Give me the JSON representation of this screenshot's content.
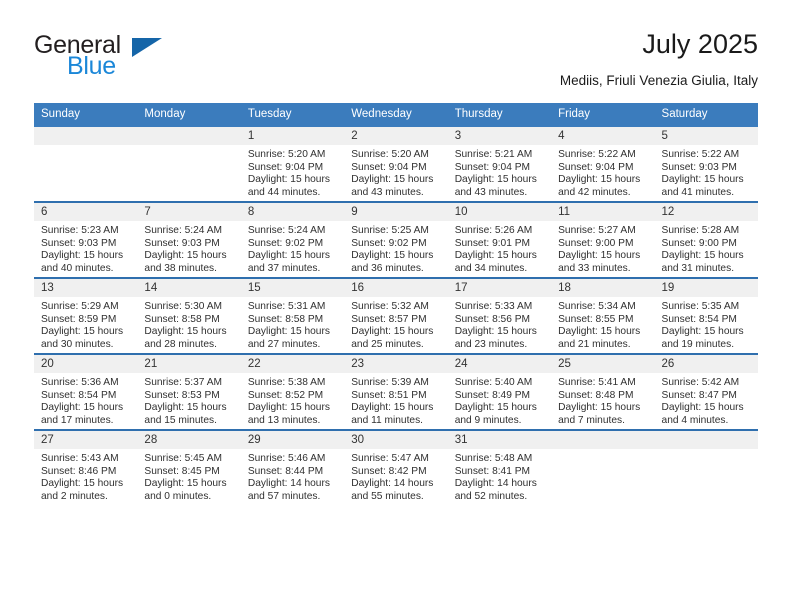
{
  "brand": {
    "line1": "General",
    "line2": "Blue",
    "flag_icon": "triangle-flag-icon",
    "colors": {
      "text": "#231f20",
      "blue": "#1b87d8",
      "flag": "#1565a8"
    }
  },
  "header": {
    "title": "July 2025",
    "subtitle": "Mediis, Friuli Venezia Giulia, Italy"
  },
  "theme": {
    "header_blue": "#3b7cbd",
    "row_divider_blue": "#2f6fae",
    "daynum_band": "#f0f0f0"
  },
  "columns": [
    "Sunday",
    "Monday",
    "Tuesday",
    "Wednesday",
    "Thursday",
    "Friday",
    "Saturday"
  ],
  "labels": {
    "sunrise_prefix": "Sunrise:",
    "sunset_prefix": "Sunset:",
    "daylight_prefix": "Daylight:"
  },
  "weeks": [
    [
      {
        "day": ""
      },
      {
        "day": ""
      },
      {
        "day": "1",
        "sunrise": "Sunrise: 5:20 AM",
        "sunset": "Sunset: 9:04 PM",
        "daylight_l1": "Daylight: 15 hours",
        "daylight_l2": "and 44 minutes."
      },
      {
        "day": "2",
        "sunrise": "Sunrise: 5:20 AM",
        "sunset": "Sunset: 9:04 PM",
        "daylight_l1": "Daylight: 15 hours",
        "daylight_l2": "and 43 minutes."
      },
      {
        "day": "3",
        "sunrise": "Sunrise: 5:21 AM",
        "sunset": "Sunset: 9:04 PM",
        "daylight_l1": "Daylight: 15 hours",
        "daylight_l2": "and 43 minutes."
      },
      {
        "day": "4",
        "sunrise": "Sunrise: 5:22 AM",
        "sunset": "Sunset: 9:04 PM",
        "daylight_l1": "Daylight: 15 hours",
        "daylight_l2": "and 42 minutes."
      },
      {
        "day": "5",
        "sunrise": "Sunrise: 5:22 AM",
        "sunset": "Sunset: 9:03 PM",
        "daylight_l1": "Daylight: 15 hours",
        "daylight_l2": "and 41 minutes."
      }
    ],
    [
      {
        "day": "6",
        "sunrise": "Sunrise: 5:23 AM",
        "sunset": "Sunset: 9:03 PM",
        "daylight_l1": "Daylight: 15 hours",
        "daylight_l2": "and 40 minutes."
      },
      {
        "day": "7",
        "sunrise": "Sunrise: 5:24 AM",
        "sunset": "Sunset: 9:03 PM",
        "daylight_l1": "Daylight: 15 hours",
        "daylight_l2": "and 38 minutes."
      },
      {
        "day": "8",
        "sunrise": "Sunrise: 5:24 AM",
        "sunset": "Sunset: 9:02 PM",
        "daylight_l1": "Daylight: 15 hours",
        "daylight_l2": "and 37 minutes."
      },
      {
        "day": "9",
        "sunrise": "Sunrise: 5:25 AM",
        "sunset": "Sunset: 9:02 PM",
        "daylight_l1": "Daylight: 15 hours",
        "daylight_l2": "and 36 minutes."
      },
      {
        "day": "10",
        "sunrise": "Sunrise: 5:26 AM",
        "sunset": "Sunset: 9:01 PM",
        "daylight_l1": "Daylight: 15 hours",
        "daylight_l2": "and 34 minutes."
      },
      {
        "day": "11",
        "sunrise": "Sunrise: 5:27 AM",
        "sunset": "Sunset: 9:00 PM",
        "daylight_l1": "Daylight: 15 hours",
        "daylight_l2": "and 33 minutes."
      },
      {
        "day": "12",
        "sunrise": "Sunrise: 5:28 AM",
        "sunset": "Sunset: 9:00 PM",
        "daylight_l1": "Daylight: 15 hours",
        "daylight_l2": "and 31 minutes."
      }
    ],
    [
      {
        "day": "13",
        "sunrise": "Sunrise: 5:29 AM",
        "sunset": "Sunset: 8:59 PM",
        "daylight_l1": "Daylight: 15 hours",
        "daylight_l2": "and 30 minutes."
      },
      {
        "day": "14",
        "sunrise": "Sunrise: 5:30 AM",
        "sunset": "Sunset: 8:58 PM",
        "daylight_l1": "Daylight: 15 hours",
        "daylight_l2": "and 28 minutes."
      },
      {
        "day": "15",
        "sunrise": "Sunrise: 5:31 AM",
        "sunset": "Sunset: 8:58 PM",
        "daylight_l1": "Daylight: 15 hours",
        "daylight_l2": "and 27 minutes."
      },
      {
        "day": "16",
        "sunrise": "Sunrise: 5:32 AM",
        "sunset": "Sunset: 8:57 PM",
        "daylight_l1": "Daylight: 15 hours",
        "daylight_l2": "and 25 minutes."
      },
      {
        "day": "17",
        "sunrise": "Sunrise: 5:33 AM",
        "sunset": "Sunset: 8:56 PM",
        "daylight_l1": "Daylight: 15 hours",
        "daylight_l2": "and 23 minutes."
      },
      {
        "day": "18",
        "sunrise": "Sunrise: 5:34 AM",
        "sunset": "Sunset: 8:55 PM",
        "daylight_l1": "Daylight: 15 hours",
        "daylight_l2": "and 21 minutes."
      },
      {
        "day": "19",
        "sunrise": "Sunrise: 5:35 AM",
        "sunset": "Sunset: 8:54 PM",
        "daylight_l1": "Daylight: 15 hours",
        "daylight_l2": "and 19 minutes."
      }
    ],
    [
      {
        "day": "20",
        "sunrise": "Sunrise: 5:36 AM",
        "sunset": "Sunset: 8:54 PM",
        "daylight_l1": "Daylight: 15 hours",
        "daylight_l2": "and 17 minutes."
      },
      {
        "day": "21",
        "sunrise": "Sunrise: 5:37 AM",
        "sunset": "Sunset: 8:53 PM",
        "daylight_l1": "Daylight: 15 hours",
        "daylight_l2": "and 15 minutes."
      },
      {
        "day": "22",
        "sunrise": "Sunrise: 5:38 AM",
        "sunset": "Sunset: 8:52 PM",
        "daylight_l1": "Daylight: 15 hours",
        "daylight_l2": "and 13 minutes."
      },
      {
        "day": "23",
        "sunrise": "Sunrise: 5:39 AM",
        "sunset": "Sunset: 8:51 PM",
        "daylight_l1": "Daylight: 15 hours",
        "daylight_l2": "and 11 minutes."
      },
      {
        "day": "24",
        "sunrise": "Sunrise: 5:40 AM",
        "sunset": "Sunset: 8:49 PM",
        "daylight_l1": "Daylight: 15 hours",
        "daylight_l2": "and 9 minutes."
      },
      {
        "day": "25",
        "sunrise": "Sunrise: 5:41 AM",
        "sunset": "Sunset: 8:48 PM",
        "daylight_l1": "Daylight: 15 hours",
        "daylight_l2": "and 7 minutes."
      },
      {
        "day": "26",
        "sunrise": "Sunrise: 5:42 AM",
        "sunset": "Sunset: 8:47 PM",
        "daylight_l1": "Daylight: 15 hours",
        "daylight_l2": "and 4 minutes."
      }
    ],
    [
      {
        "day": "27",
        "sunrise": "Sunrise: 5:43 AM",
        "sunset": "Sunset: 8:46 PM",
        "daylight_l1": "Daylight: 15 hours",
        "daylight_l2": "and 2 minutes."
      },
      {
        "day": "28",
        "sunrise": "Sunrise: 5:45 AM",
        "sunset": "Sunset: 8:45 PM",
        "daylight_l1": "Daylight: 15 hours",
        "daylight_l2": "and 0 minutes."
      },
      {
        "day": "29",
        "sunrise": "Sunrise: 5:46 AM",
        "sunset": "Sunset: 8:44 PM",
        "daylight_l1": "Daylight: 14 hours",
        "daylight_l2": "and 57 minutes."
      },
      {
        "day": "30",
        "sunrise": "Sunrise: 5:47 AM",
        "sunset": "Sunset: 8:42 PM",
        "daylight_l1": "Daylight: 14 hours",
        "daylight_l2": "and 55 minutes."
      },
      {
        "day": "31",
        "sunrise": "Sunrise: 5:48 AM",
        "sunset": "Sunset: 8:41 PM",
        "daylight_l1": "Daylight: 14 hours",
        "daylight_l2": "and 52 minutes."
      },
      {
        "day": ""
      },
      {
        "day": ""
      }
    ]
  ]
}
